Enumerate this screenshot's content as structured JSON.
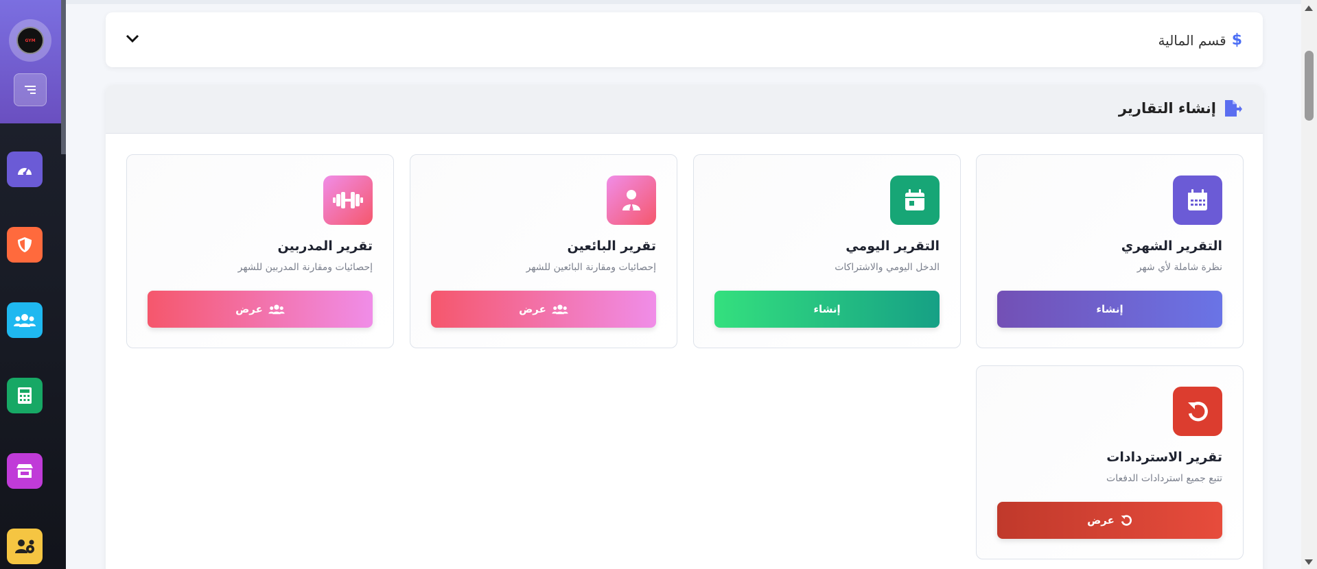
{
  "sidebar": {
    "logo_text": "GYM",
    "nav": [
      {
        "icon": "speedometer-icon",
        "color": "#6b5bd6"
      },
      {
        "icon": "shield-icon",
        "color": "#ff6a3d"
      },
      {
        "icon": "users-icon",
        "color": "#1fb8f0"
      },
      {
        "icon": "calculator-icon",
        "color": "#17a865"
      },
      {
        "icon": "store-icon",
        "color": "#c03bd8"
      },
      {
        "icon": "users-gear-icon",
        "color": "#f5c542"
      }
    ]
  },
  "finance": {
    "title": "قسم المالية",
    "icon": "dollar-icon"
  },
  "reports": {
    "title": "إنشاء التقارير",
    "icon": "file-export-icon",
    "cards": [
      {
        "title": "التقرير الشهري",
        "desc": "نظرة شاملة لأي شهر",
        "button": "إنشاء",
        "icon": "calendar-icon",
        "icon_color": "#6b5bd6",
        "btn_from": "#6a74e6",
        "btn_to": "#7350b5"
      },
      {
        "title": "التقرير اليومي",
        "desc": "الدخل اليومي والاشتراكات",
        "button": "إنشاء",
        "icon": "calendar-day-icon",
        "icon_color": "#17a676",
        "btn_from": "#16a085",
        "btn_to": "#34e07e"
      },
      {
        "title": "تقرير البائعين",
        "desc": "إحصائيات ومقارنة البائعين للشهر",
        "button": "عرض",
        "icon": "user-tie-icon",
        "icon_color": "#f06aa8",
        "btn_from": "#f08de8",
        "btn_to": "#f5576c"
      },
      {
        "title": "تقرير المدربين",
        "desc": "إحصائيات ومقارنة المدربين للشهر",
        "button": "عرض",
        "icon": "dumbbell-icon",
        "icon_color": "#f5679a",
        "btn_from": "#f08de8",
        "btn_to": "#f5576c"
      },
      {
        "title": "تقرير الاستردادات",
        "desc": "تتبع جميع استردادات الدفعات",
        "button": "عرض",
        "icon": "undo-icon",
        "icon_color": "#dc3d2f",
        "btn_from": "#e74c3c",
        "btn_to": "#c0392b"
      }
    ]
  }
}
